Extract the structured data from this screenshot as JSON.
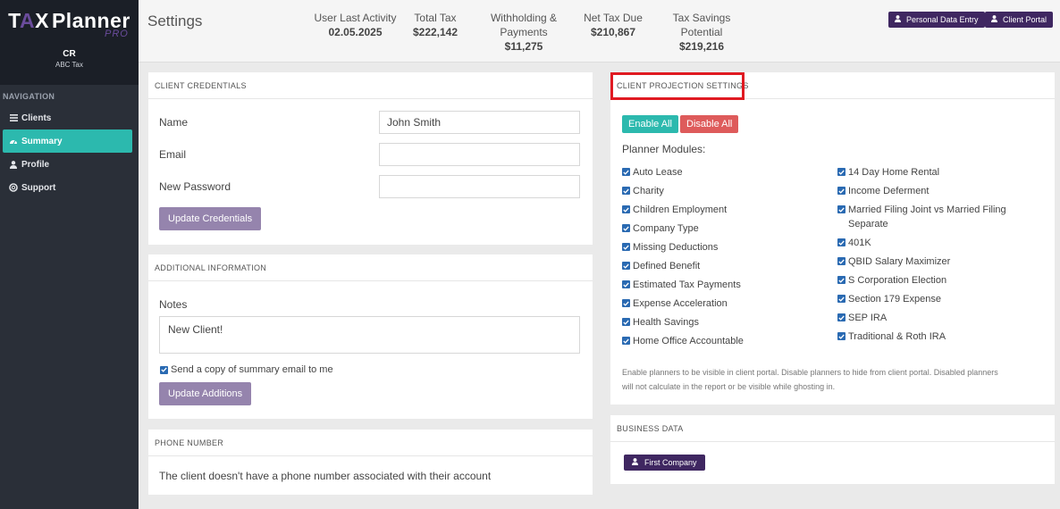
{
  "brand": {
    "logo_main": "TAXPlanner",
    "logo_sub": "PRO",
    "user_initials": "CR",
    "firm": "ABC Tax"
  },
  "nav": {
    "heading": "NAVIGATION",
    "items": [
      {
        "label": "Clients",
        "icon": "list-icon"
      },
      {
        "label": "Summary",
        "icon": "dashboard-icon",
        "active": true
      },
      {
        "label": "Profile",
        "icon": "user-icon"
      },
      {
        "label": "Support",
        "icon": "lifebuoy-icon"
      }
    ]
  },
  "header": {
    "title": "Settings",
    "stats": [
      {
        "label": "User Last Activity",
        "value": "02.05.2025"
      },
      {
        "label": "Total Tax",
        "value": "$222,142"
      },
      {
        "label_1": "Withholding &",
        "label_2": "Payments",
        "value": "$11,275"
      },
      {
        "label": "Net Tax Due",
        "value": "$210,867"
      },
      {
        "label_1": "Tax Savings",
        "label_2": "Potential",
        "value": "$219,216"
      }
    ],
    "buttons": {
      "personal_data": "Personal Data Entry",
      "client_portal": "Client Portal"
    }
  },
  "credentials": {
    "heading": "CLIENT CREDENTIALS",
    "name_label": "Name",
    "name_value": "John Smith",
    "email_label": "Email",
    "email_value": "",
    "password_label": "New Password",
    "password_value": "",
    "button": "Update Credentials"
  },
  "additional": {
    "heading": "ADDITIONAL INFORMATION",
    "notes_label": "Notes",
    "notes_value": "New Client!",
    "send_copy_label": "Send a copy of summary email to me",
    "send_copy_checked": true,
    "button": "Update Additions"
  },
  "phone": {
    "heading": "PHONE NUMBER",
    "message": "The client doesn't have a phone number associated with their account"
  },
  "projection": {
    "heading": "CLIENT PROJECTION SETTINGS",
    "enable_all": "Enable All",
    "disable_all": "Disable All",
    "modules_label": "Planner Modules:",
    "left_modules": [
      "Auto Lease",
      "Charity",
      "Children Employment",
      "Company Type",
      "Missing Deductions",
      "Defined Benefit",
      "Estimated Tax Payments",
      "Expense Acceleration",
      "Health Savings",
      "Home Office Accountable"
    ],
    "right_modules": [
      "14 Day Home Rental",
      "Income Deferment",
      "Married Filing Joint vs Married Filing Separate",
      "401K",
      "QBID Salary Maximizer",
      "S Corporation Election",
      "Section 179 Expense",
      "SEP IRA",
      "Traditional & Roth IRA"
    ],
    "footnote_1": "Enable planners to be visible in client portal. Disable planners to hide from client portal. Disabled planners",
    "footnote_2": "will not calculate in the report or be visible while ghosting in."
  },
  "business": {
    "heading": "BUSINESS DATA",
    "company_button": "First Company"
  },
  "colors": {
    "teal": "#2cb9ae",
    "purple_dark": "#3f2761",
    "purple_light": "#9584ad",
    "red": "#de5b5b",
    "highlight": "#e01a22"
  }
}
